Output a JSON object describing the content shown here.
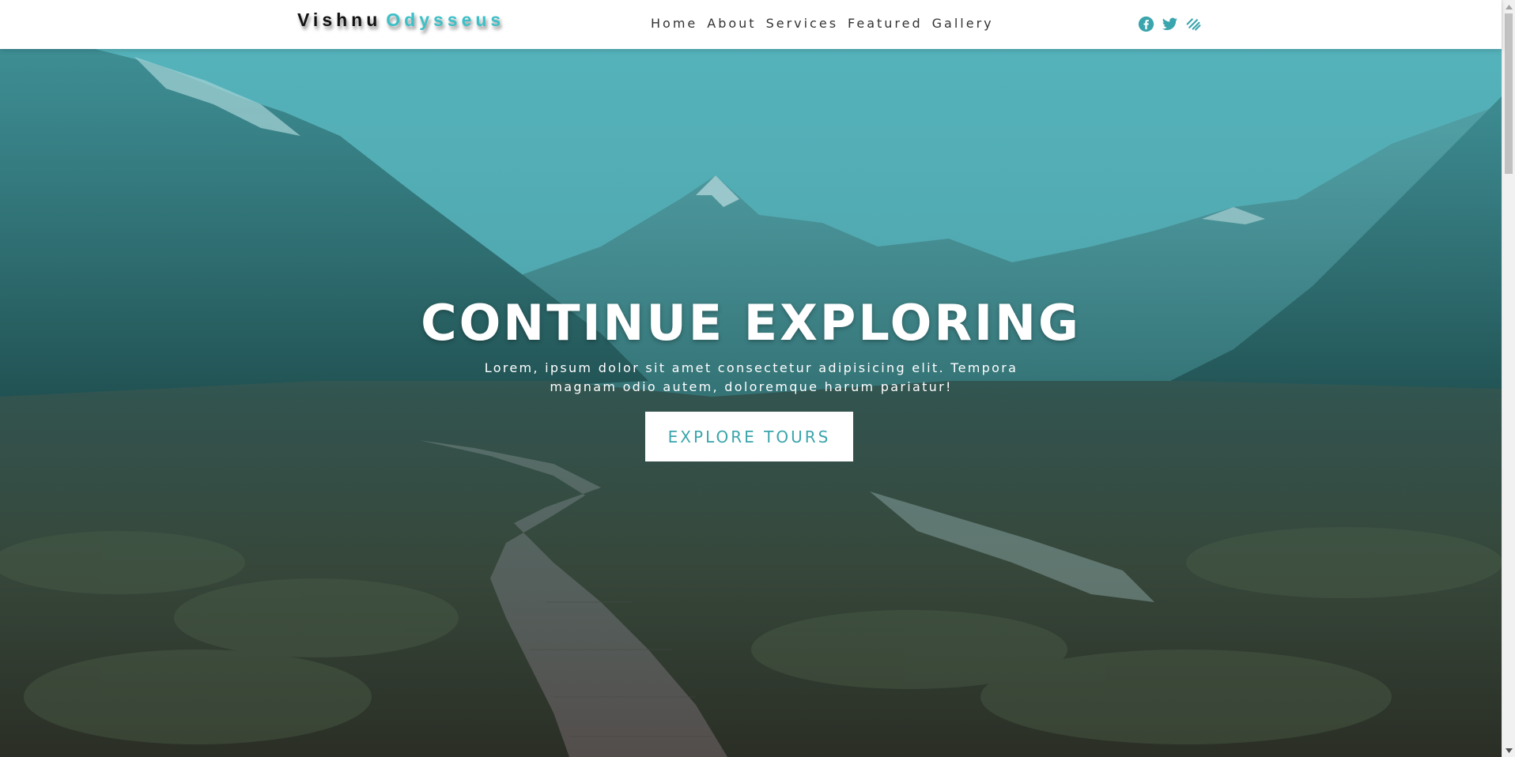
{
  "navbar": {
    "brand_first": "Vishnu",
    "brand_second": "Odysseus",
    "links": [
      {
        "label": "Home"
      },
      {
        "label": "About"
      },
      {
        "label": "Services"
      },
      {
        "label": "Featured"
      },
      {
        "label": "Gallery"
      }
    ],
    "socials": [
      {
        "icon": "facebook-icon"
      },
      {
        "icon": "twitter-icon"
      },
      {
        "icon": "squarespace-icon"
      }
    ]
  },
  "hero": {
    "title": "CONTINUE EXPLORING",
    "subtitle": "Lorem, ipsum dolor sit amet consectetur adipisicing elit. Tempora magnam odio autem, doloremque harum pariatur!",
    "button_label": "EXPLORE TOURS"
  },
  "colors": {
    "accent": "#3cc0c8",
    "brand_dark": "#111111",
    "button_text": "#3aa5ad"
  }
}
